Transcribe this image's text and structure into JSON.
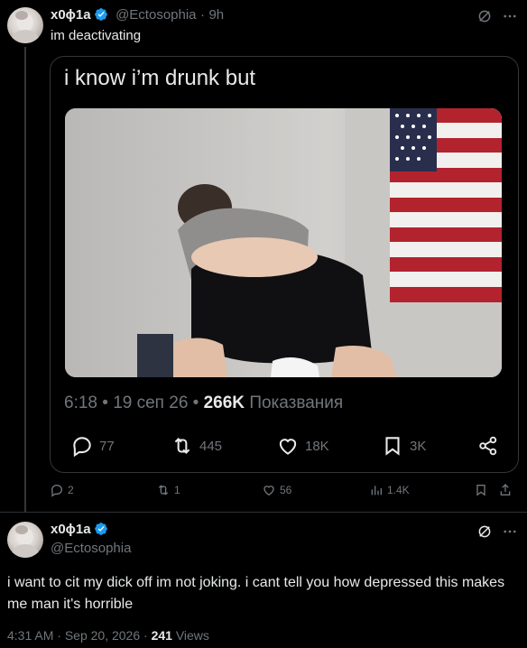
{
  "quote_tweet": {
    "author_name": "x0ϕ1a",
    "handle": "@Ectosophia",
    "separator": "·",
    "time": "9h",
    "text": "im deactivating",
    "icons": {
      "avatar": "avatar",
      "verified": "verified-badge-icon",
      "grok": "grok-icon",
      "more": "more-icon"
    }
  },
  "embedded": {
    "text": "i know i’m drunk but",
    "image_alt": "photo",
    "time": "6:18",
    "dot": "•",
    "date": "19 сеп 26",
    "views_count": "266K",
    "views_label": "Показвания",
    "actions": {
      "replies": "77",
      "retweets": "445",
      "likes": "18K",
      "bookmarks": "3K"
    }
  },
  "quote_actions": {
    "replies": "2",
    "retweets": "1",
    "likes": "56",
    "views": "1.4K"
  },
  "reply_tweet": {
    "author_name": "x0ϕ1a",
    "handle": "@Ectosophia",
    "text": "i want to cit my dick off im not joking. i cant tell you how depressed this makes me man it's horrible",
    "time": "4:31 AM",
    "separator1": "·",
    "date": "Sep 20, 2026",
    "separator2": "·",
    "views_count": "241",
    "views_label": "Views"
  },
  "colors": {
    "background": "#000000",
    "text": "#e7e9ea",
    "muted": "#71767b",
    "verified": "#1d9bf0",
    "border": "#333639"
  }
}
